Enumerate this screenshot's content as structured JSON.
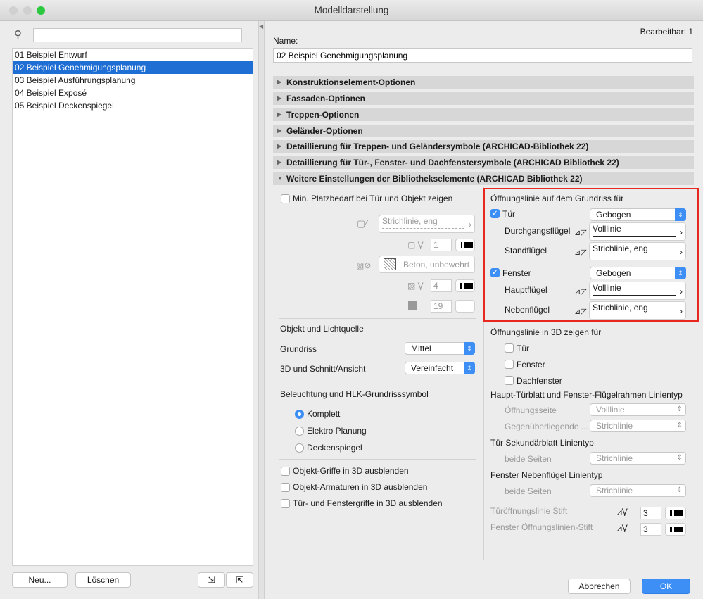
{
  "window": {
    "title": "Modelldarstellung"
  },
  "left": {
    "search_placeholder": "",
    "items": [
      "01 Beispiel Entwurf",
      "02 Beispiel Genehmigungsplanung",
      "03 Beispiel Ausführungsplanung",
      "04 Beispiel Exposé",
      "05 Beispiel Deckenspiegel"
    ],
    "selected": 1,
    "new_label": "Neu...",
    "delete_label": "Löschen"
  },
  "right": {
    "editable": "Bearbeitbar: 1",
    "name_label": "Name:",
    "name_value": "02 Beispiel Genehmigungsplanung",
    "sections": [
      "Konstruktionselement-Optionen",
      "Fassaden-Optionen",
      "Treppen-Optionen",
      "Geländer-Optionen",
      "Detaillierung für Treppen- und Geländersymbole (ARCHICAD-Bibliothek 22)",
      "Detaillierung für Tür-, Fenster- und Dachfenstersymbole (ARCHICAD Bibliothek 22)",
      "Weitere Einstellungen der Bibliothekselemente (ARCHICAD Bibliothek 22)"
    ],
    "min_space": "Min. Platzbedarf bei Tür und Objekt zeigen",
    "min_linetype": "Strichlinie, eng",
    "min_pen1": "1",
    "min_fill": "Beton, unbewehrt",
    "min_pen2": "4",
    "min_pen3": "19",
    "obj_light": "Objekt und Lichtquelle",
    "grundriss_label": "Grundriss",
    "grundriss_value": "Mittel",
    "schnitt_label": "3D und Schnitt/Ansicht",
    "schnitt_value": "Vereinfacht",
    "beleuchtung": "Beleuchtung und HLK-Grundrisssymbol",
    "radios": [
      "Komplett",
      "Elektro Planung",
      "Deckenspiegel"
    ],
    "radio_selected": 0,
    "hide": [
      "Objekt-Griffe in 3D ausblenden",
      "Objekt-Armaturen in 3D ausblenden",
      "Tür- und Fenstergriffe in 3D ausblenden"
    ],
    "opening": {
      "title": "Öffnungslinie auf dem Grundriss für",
      "door": "Tür",
      "door_value": "Gebogen",
      "door_main": "Durchgangsflügel",
      "door_main_value": "Volllinie",
      "door_second": "Standflügel",
      "door_second_value": "Strichlinie, eng",
      "window": "Fenster",
      "window_value": "Gebogen",
      "win_main": "Hauptflügel",
      "win_main_value": "Volllinie",
      "win_second": "Nebenflügel",
      "win_second_value": "Strichlinie, eng",
      "highlight_color": "#e8281e"
    },
    "opening3d": {
      "title": "Öffnungslinie in 3D zeigen für",
      "items": [
        "Tür",
        "Fenster",
        "Dachfenster"
      ]
    },
    "main_lt": {
      "title": "Haupt-Türblatt und Fenster-Flügelrahmen Linientyp",
      "row1": "Öffnungsseite",
      "row1_value": "Volllinie",
      "row2": "Gegenüberliegende ...",
      "row2_value": "Strichlinie"
    },
    "door_sec": {
      "title": "Tür Sekundärblatt Linientyp",
      "row": "beide Seiten",
      "value": "Strichlinie"
    },
    "win_sec": {
      "title": "Fenster Nebenflügel Linientyp",
      "row": "beide Seiten",
      "value": "Strichlinie"
    },
    "pen1": {
      "label": "Türöffnungslinie Stift",
      "value": "3"
    },
    "pen2": {
      "label": "Fenster Öffnungslinien-Stift",
      "value": "3"
    },
    "cancel": "Abbrechen",
    "ok": "OK"
  }
}
